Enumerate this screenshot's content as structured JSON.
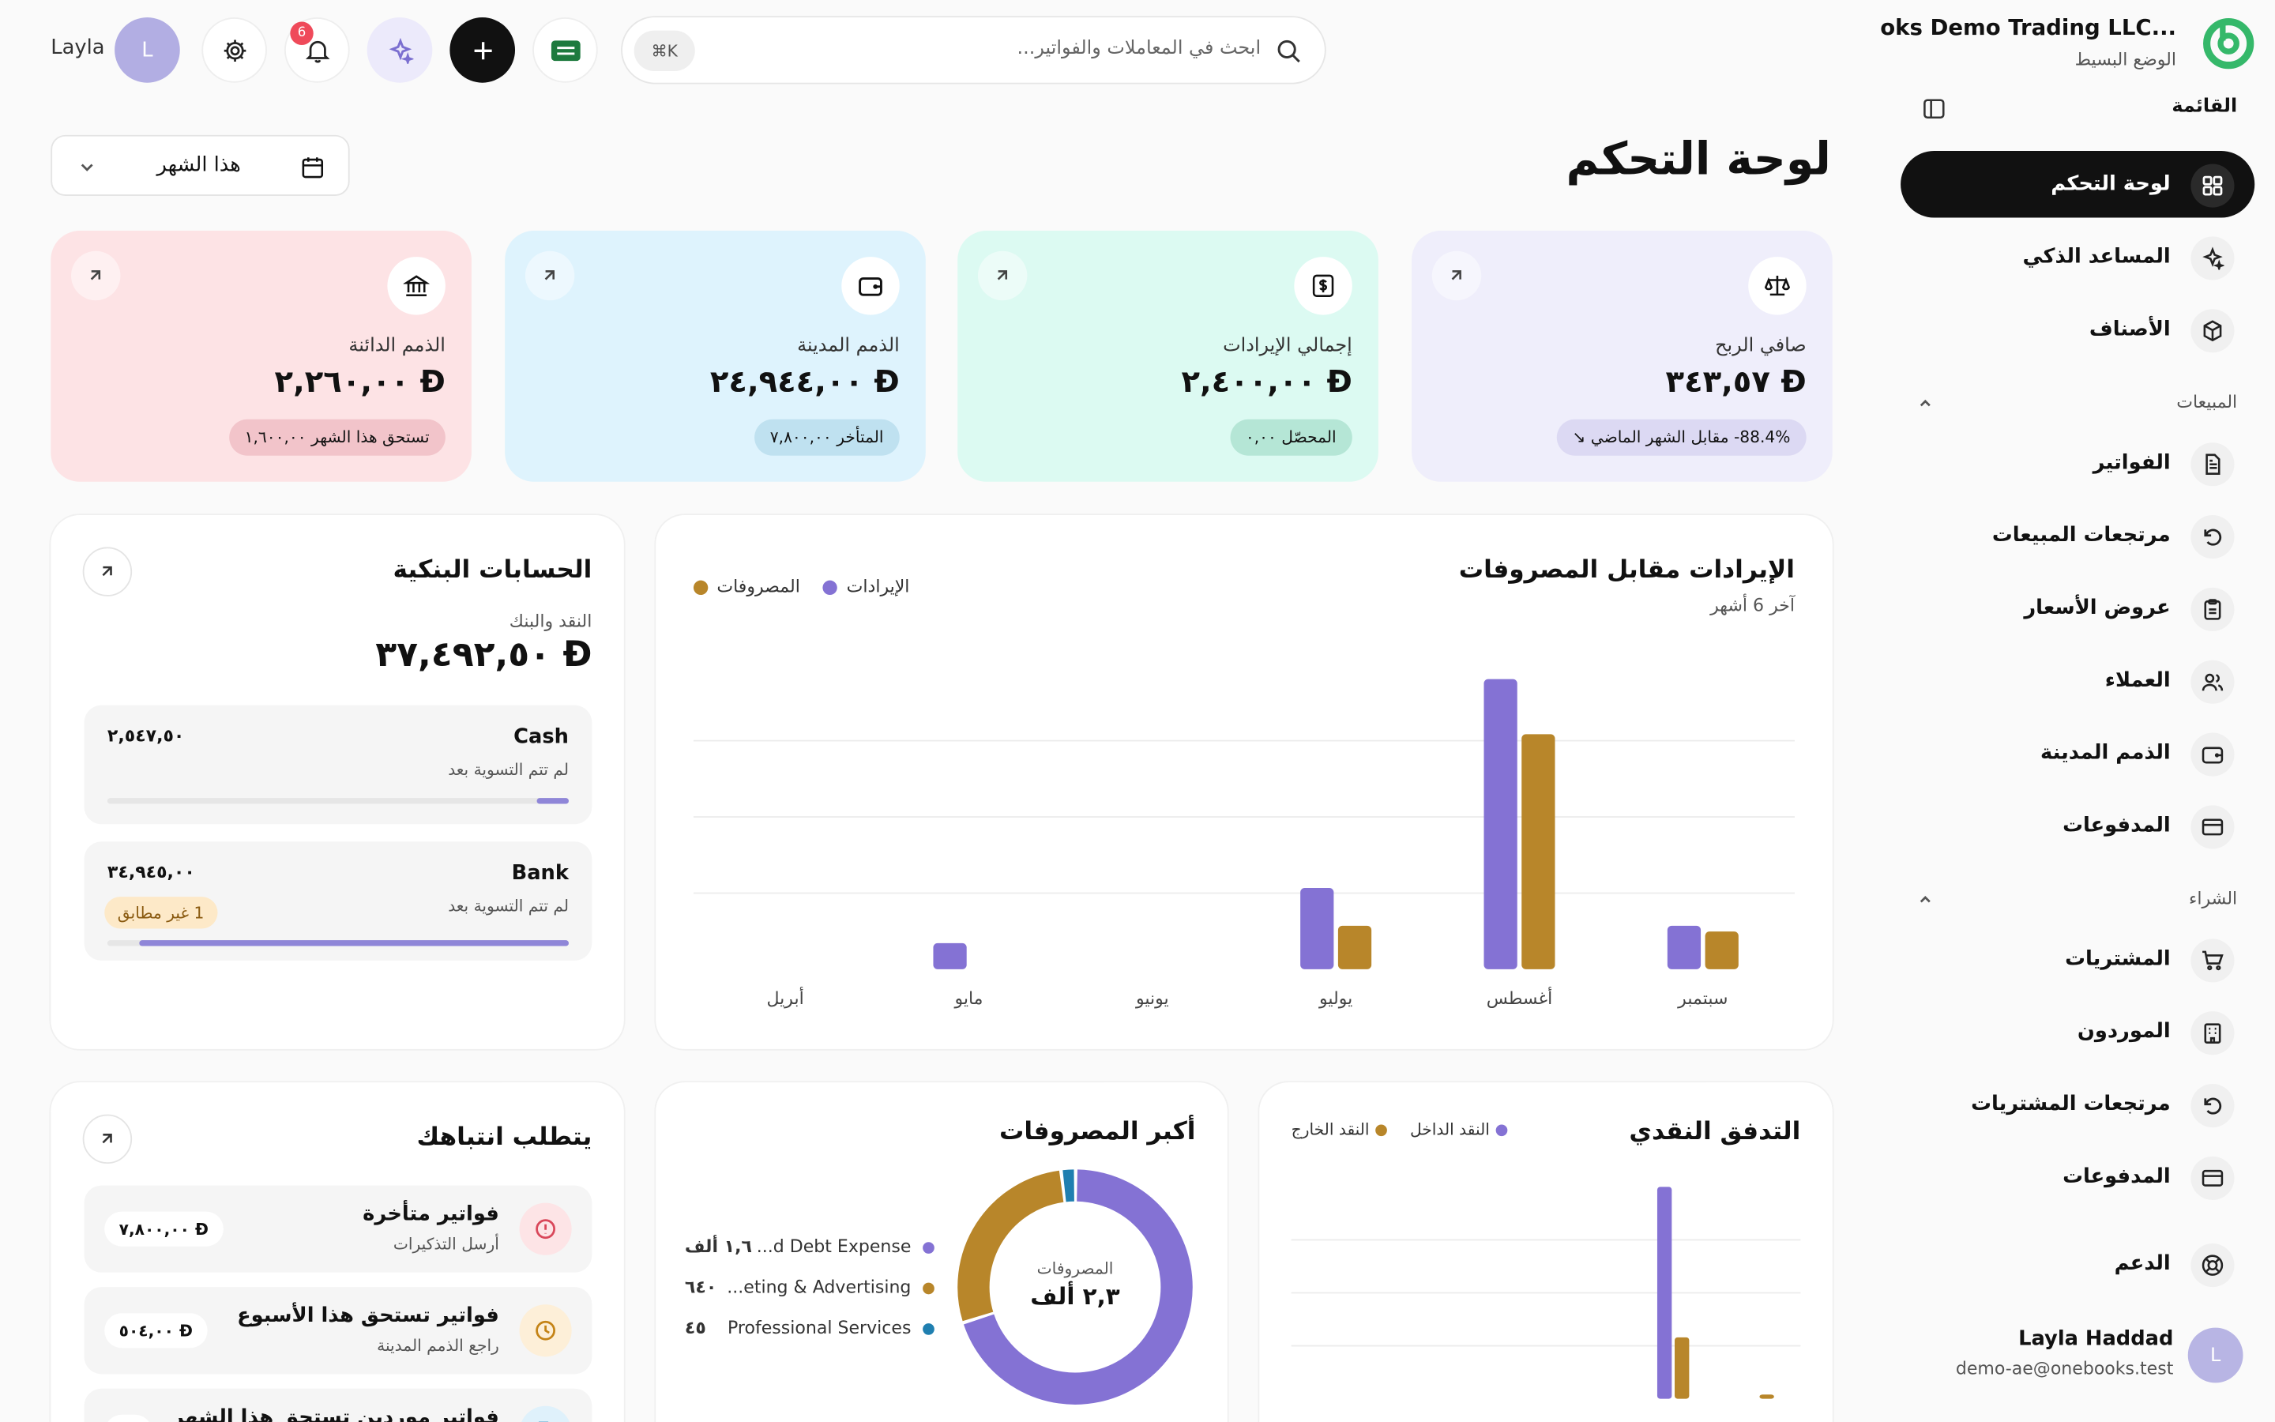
{
  "brand": {
    "name": "...oks Demo Trading LLC",
    "mode": "الوضع البسيط"
  },
  "sidebar": {
    "menu_title": "القائمة",
    "items_top": [
      {
        "label": "لوحة التحكم",
        "icon": "grid-icon",
        "active": true
      },
      {
        "label": "المساعد الذكي",
        "icon": "sparkle-icon"
      },
      {
        "label": "الأصناف",
        "icon": "box-icon"
      }
    ],
    "sales_label": "المبيعات",
    "sales_items": [
      {
        "label": "الفواتير",
        "icon": "file-icon"
      },
      {
        "label": "مرتجعات المبيعات",
        "icon": "undo-icon"
      },
      {
        "label": "عروض الأسعار",
        "icon": "clipboard-icon"
      },
      {
        "label": "العملاء",
        "icon": "users-icon"
      },
      {
        "label": "الذمم المدينة",
        "icon": "wallet-icon"
      },
      {
        "label": "المدفوعات",
        "icon": "card-icon"
      }
    ],
    "purchase_label": "الشراء",
    "purchase_items": [
      {
        "label": "المشتريات",
        "icon": "cart-icon"
      },
      {
        "label": "الموردون",
        "icon": "building-icon"
      },
      {
        "label": "مرتجعات المشتريات",
        "icon": "undo-icon"
      },
      {
        "label": "المدفوعات",
        "icon": "card-icon"
      }
    ],
    "support_label": "الدعم",
    "user": {
      "name": "Layla Haddad",
      "email": "demo-ae@onebooks.test",
      "initial": "L"
    }
  },
  "topbar": {
    "search_placeholder": "ابحث في المعاملات والفواتير...",
    "shortcut": "⌘K",
    "notifications_count": "6",
    "user_name": "Layla",
    "user_initial": "L"
  },
  "page": {
    "title": "لوحة التحكم",
    "date_filter": "هذا الشهر"
  },
  "kpis": {
    "net_profit": {
      "label": "صافي الربح",
      "value": "٣٤٣,٥٧",
      "pill": "‎-88.4%‏ مقابل الشهر الماضي",
      "bg": "#efeefb",
      "pill_bg": "#dcd9f3"
    },
    "revenue": {
      "label": "إجمالي الإيرادات",
      "value": "٢,٤٠٠,٠٠",
      "pill": "المحصّل ٠,٠٠",
      "bg": "#dcfaf2",
      "pill_bg": "#b5e6d6"
    },
    "receivables": {
      "label": "الذمم المدينة",
      "value": "٢٤,٩٤٤,٠٠",
      "pill": "المتأخر ٧,٨٠٠,٠٠",
      "bg": "#def3fd",
      "pill_bg": "#bfe1f0"
    },
    "payables": {
      "label": "الذمم الدائنة",
      "value": "٢,٢٦٠,٠٠",
      "pill": "تستحق هذا الشهر ١,٦٠٠,٠٠",
      "bg": "#fde3e5",
      "pill_bg": "#f2c4ca"
    }
  },
  "currency_symbol": "Ð",
  "revenue_chart": {
    "title": "الإيرادات مقابل المصروفات",
    "subtitle": "آخر 6 أشهر",
    "legend_revenue": "الإيرادات",
    "legend_expenses": "المصروفات"
  },
  "chart_data": {
    "type": "bar",
    "categories": [
      "أبريل",
      "مايو",
      "يونيو",
      "يوليو",
      "أغسطس",
      "سبتمبر"
    ],
    "series": [
      {
        "name": "الإيرادات",
        "color": "#8472d4",
        "values": [
          0,
          0.09,
          0,
          0.28,
          1.0,
          0.15
        ]
      },
      {
        "name": "المصروفات",
        "color": "#b8862a",
        "values": [
          0,
          0,
          0,
          0.15,
          0.81,
          0.13
        ]
      }
    ],
    "ylim": [
      0,
      1.05
    ],
    "grid": true,
    "legend": "top-left"
  },
  "bank": {
    "title": "الحسابات البنكية",
    "subtitle": "النقد والبنك",
    "total": "٣٧,٤٩٢,٥٠",
    "accounts": [
      {
        "name": "Cash",
        "status": "لم تتم التسوية بعد",
        "value": "٢,٥٤٧,٥٠",
        "progress": 0.07
      },
      {
        "name": "Bank",
        "status": "لم تتم التسوية بعد",
        "value": "٣٤,٩٤٥,٠٠",
        "progress": 0.93,
        "warning": "1 غير مطابق"
      }
    ]
  },
  "cashflow": {
    "title": "التدفق النقدي",
    "legend_in": "النقد الداخل",
    "legend_out": "النقد الخارج",
    "bars": [
      {
        "in": 0,
        "out": 0
      },
      {
        "in": 0,
        "out": 0
      },
      {
        "in": 0,
        "out": 0
      },
      {
        "in": 0,
        "out": 0
      },
      {
        "in": 1.0,
        "out": 0.29
      },
      {
        "in": 0,
        "out": 0.02
      }
    ]
  },
  "expenses": {
    "title": "أكبر المصروفات",
    "center_label": "المصروفات",
    "center_value": "٢,٣ ألف",
    "items": [
      {
        "name": "...d Debt Expense",
        "value": "١,٦ ألف",
        "color": "#8472d4",
        "share": 0.7
      },
      {
        "name": "...eting & Advertising",
        "value": "٦٤٠",
        "color": "#b8862a",
        "share": 0.28
      },
      {
        "name": "Professional Services",
        "value": "٤٥",
        "color": "#1f7fb0",
        "share": 0.02
      }
    ]
  },
  "attention": {
    "title": "يتطلب انتباهك",
    "items": [
      {
        "title": "فواتير متأخرة",
        "sub": "أرسل التذكيرات",
        "amount": "٧,٨٠٠,٠٠",
        "icon": "alert-icon",
        "icon_bg": "#fde4e6",
        "icon_color": "#d9475a"
      },
      {
        "title": "فواتير تستحق هذا الأسبوع",
        "sub": "راجع الذمم المدينة",
        "amount": "٥٠٤,٠٠",
        "icon": "clock-icon",
        "icon_bg": "#fdefd8",
        "icon_color": "#c48316"
      },
      {
        "title": "فواتير موردين تستحق هذا الشهر",
        "sub": "",
        "amount": "",
        "icon": "file-icon",
        "icon_bg": "#dff1fb",
        "icon_color": "#2a86b8"
      }
    ]
  }
}
